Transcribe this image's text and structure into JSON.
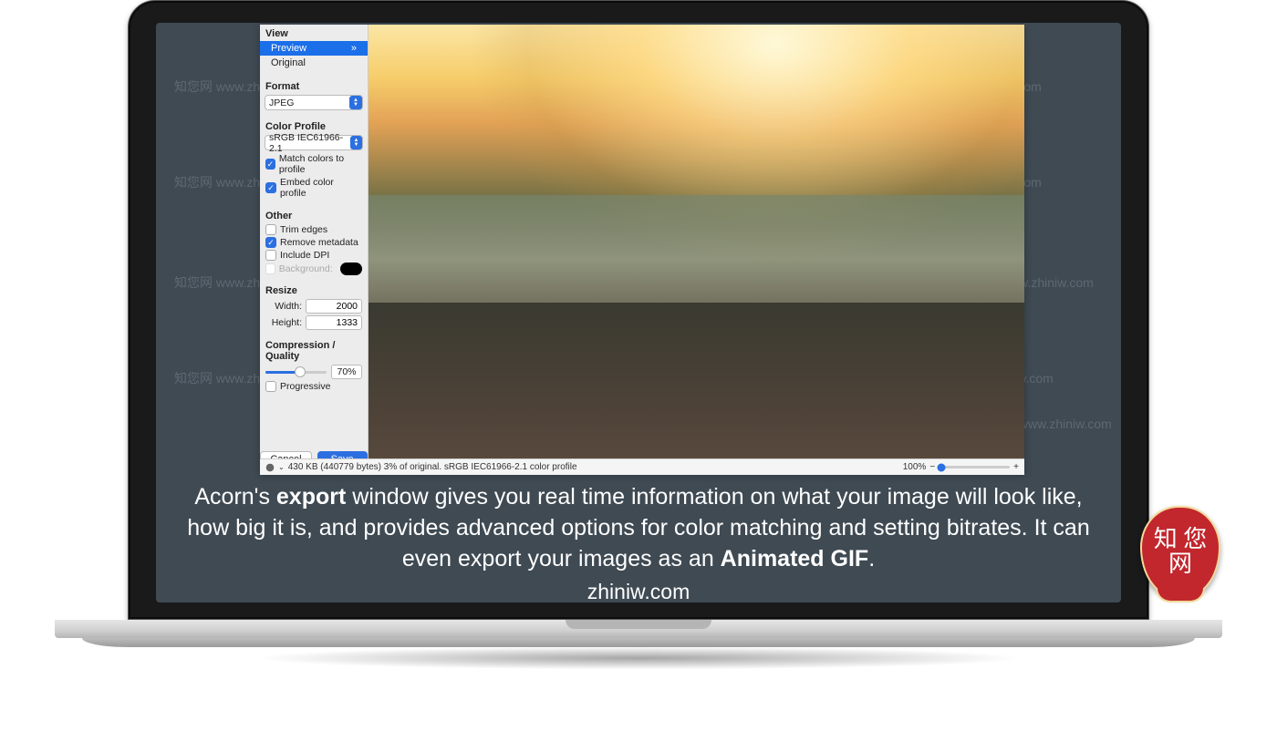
{
  "sidebar": {
    "view": {
      "title": "View",
      "preview": "Preview",
      "preview_arrow": "»",
      "original": "Original"
    },
    "format": {
      "title": "Format",
      "value": "JPEG"
    },
    "color_profile": {
      "title": "Color Profile",
      "value": "sRGB IEC61966-2.1",
      "match": "Match colors to profile",
      "embed": "Embed color profile"
    },
    "other": {
      "title": "Other",
      "trim": "Trim edges",
      "remove_meta": "Remove metadata",
      "include_dpi": "Include DPI",
      "background": "Background:"
    },
    "resize": {
      "title": "Resize",
      "width_label": "Width:",
      "width_value": "2000",
      "height_label": "Height:",
      "height_value": "1333"
    },
    "quality": {
      "title": "Compression / Quality",
      "value": "70%",
      "progressive": "Progressive"
    },
    "buttons": {
      "cancel": "Cancel",
      "save": "Save"
    }
  },
  "statusbar": {
    "info": "430 KB (440779 bytes) 3% of original. sRGB IEC61966-2.1 color profile",
    "zoom": "100%",
    "minus": "−",
    "plus": "+"
  },
  "watermark": {
    "text": "知您网 www.zhiniw.com"
  },
  "caption": {
    "line_pre": "Acorn's ",
    "export": "export",
    "line_mid": " window gives you real time information on what your image will look like, how big it is, and provides advanced options for color matching and setting bitrates. It can even export your images as an ",
    "animated": "Animated GIF",
    "line_end": ".",
    "site": "zhiniw.com"
  },
  "badge": {
    "text": "知\n您网"
  }
}
